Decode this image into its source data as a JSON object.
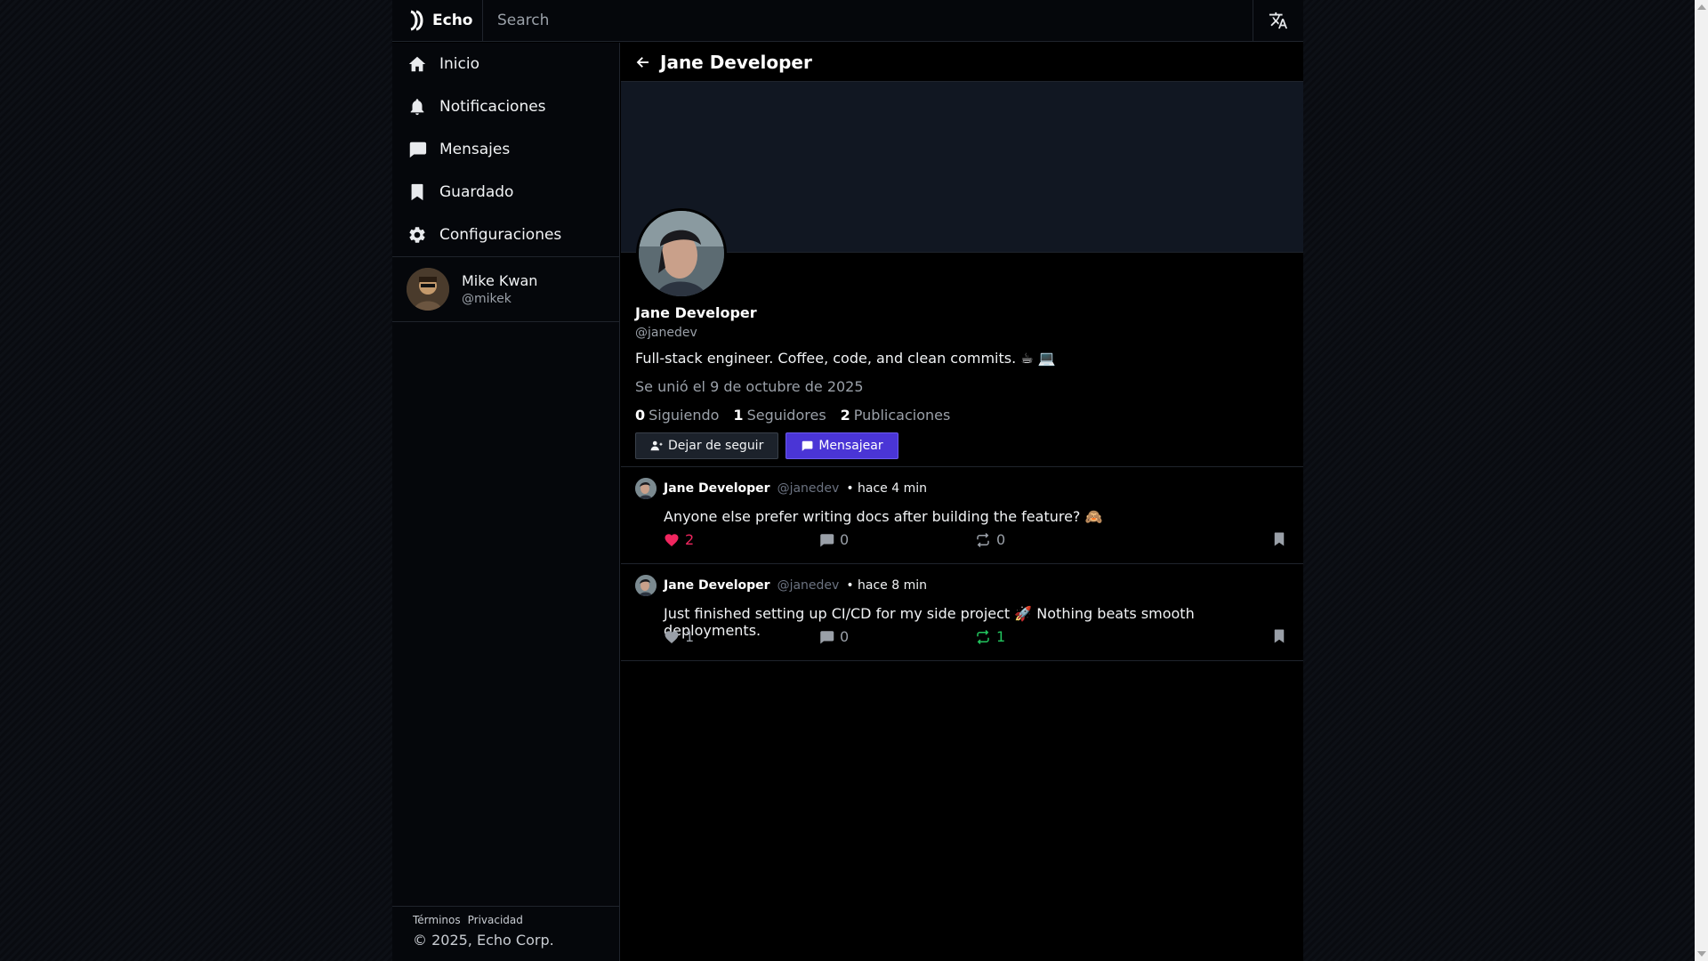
{
  "topbar": {
    "brand": "Echo",
    "search_placeholder": "Search"
  },
  "sidebar": {
    "items": [
      {
        "label": "Inicio",
        "icon": "home-icon"
      },
      {
        "label": "Notificaciones",
        "icon": "bell-icon"
      },
      {
        "label": "Mensajes",
        "icon": "message-icon"
      },
      {
        "label": "Guardado",
        "icon": "bookmark-icon"
      },
      {
        "label": "Configuraciones",
        "icon": "gear-icon"
      }
    ],
    "user": {
      "name": "Mike Kwan",
      "handle": "@mikek"
    },
    "footer": {
      "terms": "Términos",
      "privacy": "Privacidad",
      "copyright": "© 2025, Echo Corp."
    }
  },
  "profile": {
    "header_title": "Jane Developer",
    "name": "Jane Developer",
    "handle": "@janedev",
    "bio": "Full-stack engineer. Coffee, code, and clean commits. ☕ 💻",
    "joined": "Se unió el 9 de octubre de 2025",
    "following_count": "0",
    "following_label": "Siguiendo",
    "followers_count": "1",
    "followers_label": "Seguidores",
    "posts_count": "2",
    "posts_label": "Publicaciones",
    "unfollow_label": "Dejar de seguir",
    "message_label": "Mensajear"
  },
  "posts": [
    {
      "author": "Jane Developer",
      "handle": "@janedev",
      "time": "• hace 4 min",
      "text": "Anyone else prefer writing docs after building the feature? 🙈",
      "likes": "2",
      "comments": "0",
      "reposts": "0",
      "liked": true,
      "reposted": false
    },
    {
      "author": "Jane Developer",
      "handle": "@janedev",
      "time": "• hace 8 min",
      "text": "Just finished setting up CI/CD for my side project 🚀 Nothing beats smooth deployments.",
      "likes": "1",
      "comments": "0",
      "reposts": "1",
      "liked": false,
      "reposted": true
    }
  ],
  "colors": {
    "accent": "#4a35d6",
    "like": "#f0265f",
    "repost": "#22c55e"
  }
}
